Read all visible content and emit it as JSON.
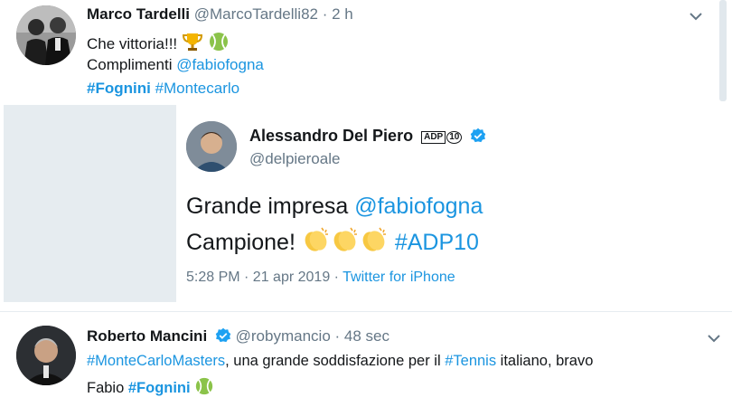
{
  "tweet1": {
    "name": "Marco Tardelli",
    "handle": "@MarcoTardelli82",
    "time": "· 2 h",
    "line1": "Che vittoria!!!",
    "line2_prefix": "Complimenti ",
    "line2_mention": "@fabiofogna",
    "hashtag1": "#Fognini",
    "hashtag2": "#Montecarlo"
  },
  "quoted": {
    "name": "Alessandro Del Piero",
    "badge": "ADP",
    "badge_num": "10",
    "handle": "@delpieroale",
    "line1_prefix": "Grande impresa ",
    "line1_mention": "@fabiofogna",
    "line2_prefix": "Campione!",
    "line2_hashtag": "#ADP10",
    "timestamp": "5:28 PM · 21 apr 2019 · ",
    "source": "Twitter for iPhone"
  },
  "tweet3": {
    "name": "Roberto Mancini",
    "handle": "@robymancio",
    "time": "· 48 sec",
    "hashtag_masters": "#MonteCarloMasters",
    "text_mid": ", una grande soddisfazione per il ",
    "hashtag_tennis": "#Tennis",
    "text_end": " italiano, bravo",
    "line2_prefix": "Fabio ",
    "hashtag_fognini": "#Fognini"
  },
  "colors": {
    "link": "#1b95e0",
    "verified": "#1da1f2",
    "meta": "#657786"
  },
  "icons": [
    "chevron-down-icon",
    "trophy-icon",
    "tennis-ball-icon",
    "clapping-hands-icon",
    "verified-badge-icon"
  ]
}
